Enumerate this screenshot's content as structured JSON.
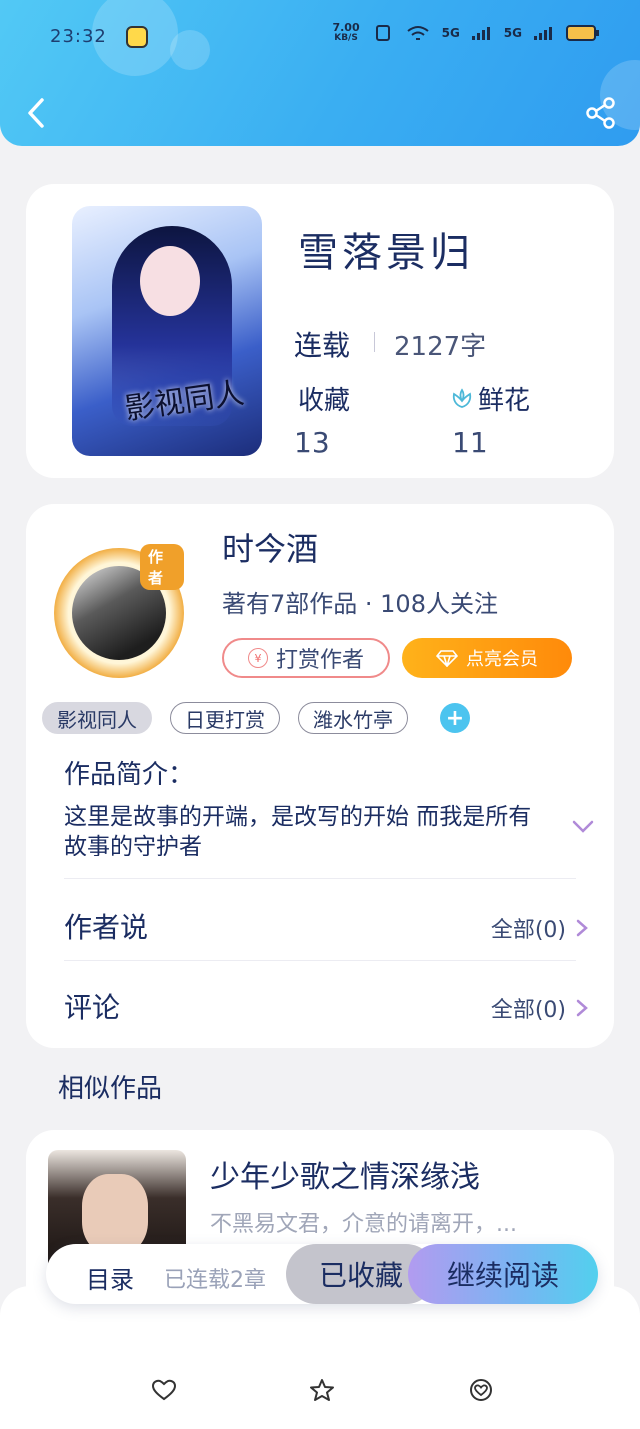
{
  "status_bar": {
    "time": "23:32",
    "speed_value": "7.00",
    "speed_unit": "KB/S",
    "sim1": "5G",
    "sim2": "5G"
  },
  "header": {
    "back_icon": "chevron-left-icon",
    "share_icon": "share-icon"
  },
  "book": {
    "title": "雪落景归",
    "status": "连载",
    "word_count": "2127字",
    "collect_label": "收藏",
    "collect_count": "13",
    "flower_label": "鲜花",
    "flower_count": "11",
    "cover_calligraphy": "影视同人"
  },
  "author": {
    "name": "时今酒",
    "badge": "作者",
    "meta": "著有7部作品 · 108人关注",
    "tip_label": "打赏作者",
    "vip_label": "点亮会员",
    "tags": [
      "影视同人",
      "日更打赏",
      "潍水竹亭"
    ],
    "intro_label": "作品简介：",
    "intro_text": "这里是故事的开端，是改写的开始 而我是所有故事的守护者",
    "author_says_label": "作者说",
    "author_says_value": "全部(0)",
    "comments_label": "评论",
    "comments_value": "全部(0)"
  },
  "similar": {
    "heading": "相似作品",
    "items": [
      {
        "title": "少年少歌之情深缘浅",
        "desc": "不黑易文君，介意的请离开，..."
      }
    ]
  },
  "float_bar": {
    "toc_label": "目录",
    "serial_label": "已连载2章",
    "collected_label": "已收藏",
    "read_label": "继续阅读"
  },
  "bottom_bar": {
    "icons": [
      "heart-icon",
      "star-icon",
      "heart-badge-icon"
    ]
  },
  "colors": {
    "header_start": "#52c9f5",
    "header_end": "#2f9cf0",
    "vip_orange": "#ff9a10",
    "tag_blue": "#4cc4ef",
    "text_navy": "#1b2d62"
  }
}
